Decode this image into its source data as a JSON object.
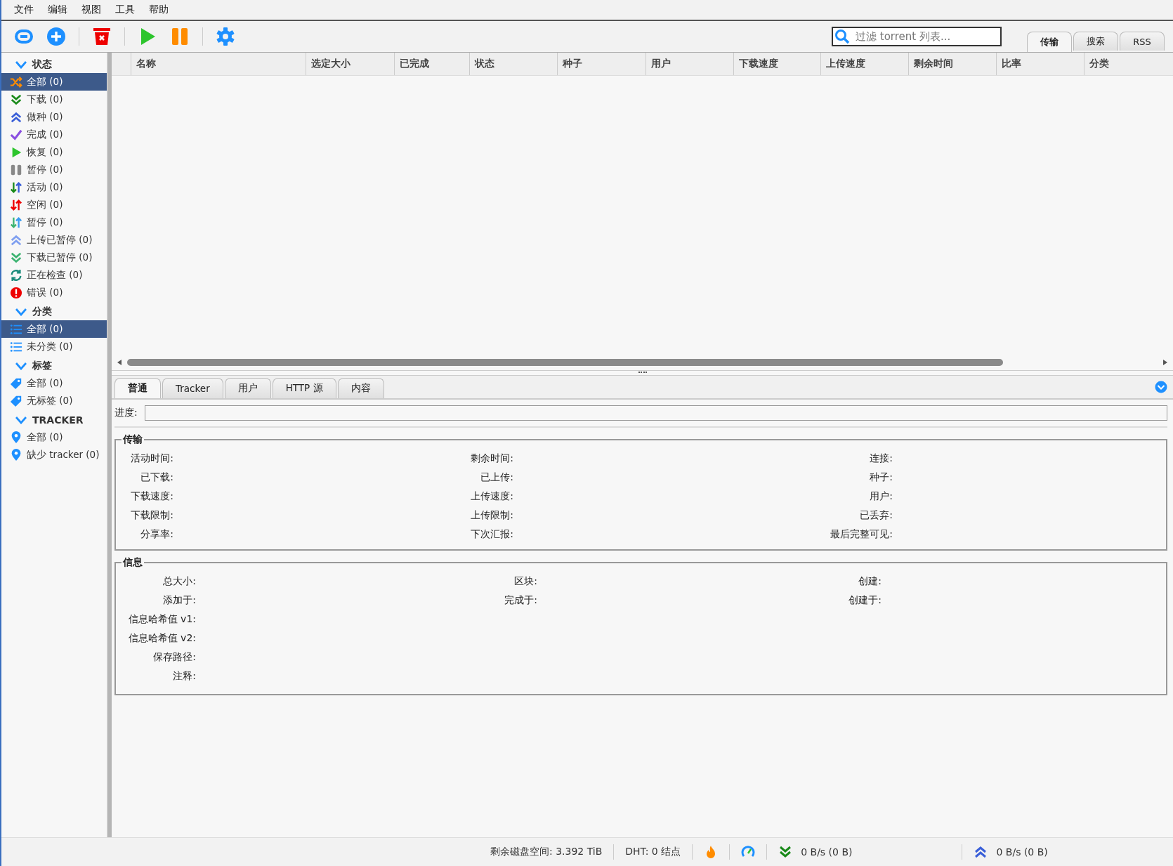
{
  "menu": [
    "文件",
    "编辑",
    "视图",
    "工具",
    "帮助"
  ],
  "search": {
    "placeholder": "过滤 torrent 列表..."
  },
  "view_tabs": [
    {
      "label": "传输",
      "selected": true
    },
    {
      "label": "搜索",
      "selected": false
    },
    {
      "label": "RSS",
      "selected": false
    }
  ],
  "sidebar": [
    {
      "title": "状态",
      "expanded": true,
      "items": [
        {
          "label": "全部 (0)",
          "kind": "shuffle",
          "selected": true
        },
        {
          "label": "下载 (0)",
          "kind": "down",
          "selected": false
        },
        {
          "label": "做种 (0)",
          "kind": "up",
          "selected": false
        },
        {
          "label": "完成 (0)",
          "kind": "check",
          "selected": false
        },
        {
          "label": "恢复 (0)",
          "kind": "play",
          "selected": false
        },
        {
          "label": "暂停 (0)",
          "kind": "pause",
          "selected": false
        },
        {
          "label": "活动 (0)",
          "kind": "active",
          "selected": false
        },
        {
          "label": "空闲 (0)",
          "kind": "idle",
          "selected": false
        },
        {
          "label": "暂停 (0)",
          "kind": "stalled",
          "selected": false
        },
        {
          "label": "上传已暂停 (0)",
          "kind": "uppaused",
          "selected": false
        },
        {
          "label": "下载已暂停 (0)",
          "kind": "downpaused",
          "selected": false
        },
        {
          "label": "正在检查 (0)",
          "kind": "checking",
          "selected": false
        },
        {
          "label": "错误 (0)",
          "kind": "error",
          "selected": false
        }
      ]
    },
    {
      "title": "分类",
      "expanded": true,
      "items": [
        {
          "label": "全部 (0)",
          "kind": "list",
          "selected": true
        },
        {
          "label": "未分类 (0)",
          "kind": "list",
          "selected": false
        }
      ]
    },
    {
      "title": "标签",
      "expanded": true,
      "items": [
        {
          "label": "全部 (0)",
          "kind": "tag",
          "selected": false
        },
        {
          "label": "无标签 (0)",
          "kind": "tag",
          "selected": false
        }
      ]
    },
    {
      "title": "TRACKER",
      "expanded": true,
      "items": [
        {
          "label": "全部 (0)",
          "kind": "pin",
          "selected": false
        },
        {
          "label": "缺少 tracker (0)",
          "kind": "pin",
          "selected": false
        }
      ]
    }
  ],
  "table": {
    "columns": [
      "名称",
      "选定大小",
      "已完成",
      "状态",
      "种子",
      "用户",
      "下载速度",
      "上传速度",
      "剩余时间",
      "比率",
      "分类"
    ]
  },
  "detail_tabs": [
    {
      "label": "普通",
      "selected": true
    },
    {
      "label": "Tracker",
      "selected": false
    },
    {
      "label": "用户",
      "selected": false
    },
    {
      "label": "HTTP 源",
      "selected": false
    },
    {
      "label": "内容",
      "selected": false
    }
  ],
  "progress": {
    "label": "进度:",
    "level": 0
  },
  "transfer": {
    "title": "传输",
    "columns": [
      [
        "活动时间:",
        "已下载:",
        "下载速度:",
        "下载限制:",
        "分享率:"
      ],
      [
        "剩余时间:",
        "已上传:",
        "上传速度:",
        "上传限制:",
        "下次汇报:"
      ],
      [
        "连接:",
        "种子:",
        "用户:",
        "已丢弃:",
        "最后完整可见:"
      ]
    ]
  },
  "info": {
    "title": "信息",
    "columns": [
      [
        "总大小:",
        "添加于:",
        "信息哈希值 v1:",
        "信息哈希值 v2:",
        "保存路径:",
        "注释:"
      ],
      [
        "区块:",
        "完成于:"
      ],
      [
        "创建:",
        "创建于:"
      ]
    ]
  },
  "status_bar": {
    "free_space": "剩余磁盘空间: 3.392 TiB",
    "dht": "DHT: 0 结点",
    "download": "0 B/s (0 B)",
    "upload": "0 B/s (0 B)"
  }
}
